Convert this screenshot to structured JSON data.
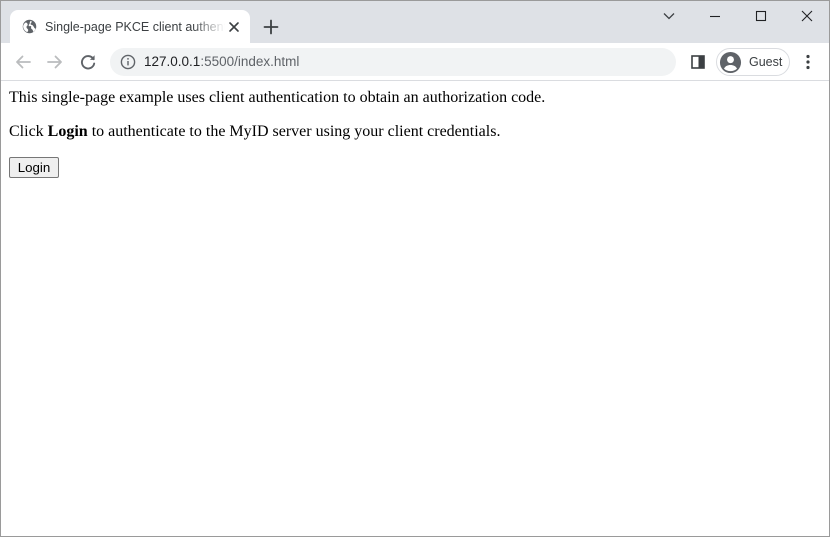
{
  "browser": {
    "tab": {
      "title": "Single-page PKCE client authentication",
      "favicon": "globe-icon",
      "close_icon": "close-icon"
    },
    "new_tab_icon": "plus-icon",
    "window_controls": [
      "tab-search-chevron-icon",
      "minimize-icon",
      "maximize-icon",
      "close-icon"
    ],
    "toolbar": {
      "back_icon": "arrow-left-icon",
      "forward_icon": "arrow-right-icon",
      "reload_icon": "reload-icon",
      "site_info_icon": "info-icon",
      "url_host": "127.0.0.1",
      "url_rest": ":5500/index.html",
      "side_panel_icon": "side-panel-icon",
      "profile_name": "Guest",
      "menu_icon": "kebab-menu-icon"
    },
    "colors": {
      "tabstrip": "#dee1e6",
      "omnibox": "#f1f3f4",
      "icon": "#5f6368"
    }
  },
  "page": {
    "intro": "This single-page example uses client authentication to obtain an authorization code.",
    "instruction_prefix": "Click ",
    "instruction_bold": "Login",
    "instruction_suffix": " to authenticate to the MyID server using your client credentials.",
    "login_button": "Login"
  }
}
